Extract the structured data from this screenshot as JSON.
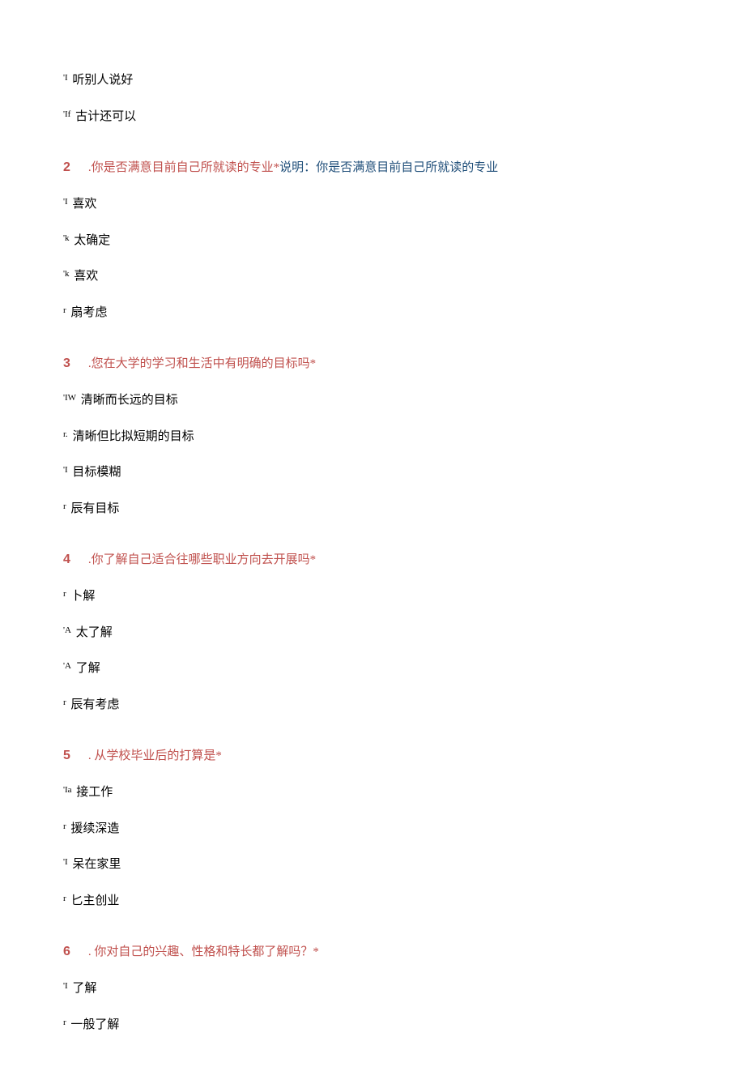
{
  "orphan_opts": [
    {
      "prefix": "'I",
      "text": "听别人说好"
    },
    {
      "prefix": "'If",
      "text": "古计还可以"
    }
  ],
  "questions": [
    {
      "num": "2",
      "title": ".你是否满意目前自己所就读的专业*",
      "note_label": "说明：",
      "note": "你是否满意目前自己所就读的专业",
      "opts": [
        {
          "prefix": "'I",
          "text": "喜欢"
        },
        {
          "prefix": "'k",
          "text": "太确定"
        },
        {
          "prefix": "'k",
          "text": "喜欢"
        },
        {
          "prefix": "r",
          "text": "扇考虑"
        }
      ]
    },
    {
      "num": "3",
      "title": ".您在大学的学习和生活中有明确的目标吗*",
      "opts": [
        {
          "prefix": "'IW",
          "text": "清晰而长远的目标"
        },
        {
          "prefix": "r.",
          "text": "清晰但比拟短期的目标"
        },
        {
          "prefix": "'I",
          "text": "目标模糊"
        },
        {
          "prefix": "r",
          "text": "辰有目标"
        }
      ]
    },
    {
      "num": "4",
      "title": ".你了解自己适合往哪些职业方向去开展吗*",
      "opts": [
        {
          "prefix": "r",
          "text": "卜解"
        },
        {
          "prefix": "'A",
          "text": "太了解"
        },
        {
          "prefix": "'A",
          "text": "了解"
        },
        {
          "prefix": "r",
          "text": "辰有考虑"
        }
      ]
    },
    {
      "num": "5",
      "title": ". 从学校毕业后的打算是*",
      "opts": [
        {
          "prefix": "'Ia",
          "text": "接工作"
        },
        {
          "prefix": "r",
          "text": "援续深造"
        },
        {
          "prefix": "'I",
          "text": "呆在家里"
        },
        {
          "prefix": "r",
          "text": "匕主创业"
        }
      ]
    },
    {
      "num": "6",
      "title": ". 你对自己的兴趣、性格和特长都了解吗？*",
      "opts": [
        {
          "prefix": "'I",
          "text": "了解"
        },
        {
          "prefix": "r",
          "text": "一般了解"
        }
      ]
    }
  ]
}
